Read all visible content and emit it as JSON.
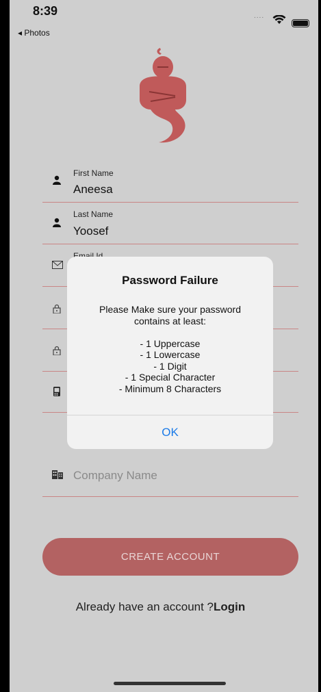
{
  "status_bar": {
    "time": "8:39",
    "back_label": "◂ Photos",
    "signal": "....",
    "battery_level": 1.0
  },
  "form": {
    "first_name": {
      "label": "First Name",
      "value": "Aneesa",
      "icon": "user-icon"
    },
    "last_name": {
      "label": "Last Name",
      "value": "Yoosef",
      "icon": "user-icon"
    },
    "email": {
      "label": "Email Id",
      "icon": "envelope-icon"
    },
    "password": {
      "icon": "lock-icon"
    },
    "confirm_password": {
      "icon": "lock-icon"
    },
    "phone": {
      "icon": "phone-icon"
    },
    "company": {
      "placeholder": "Company Name",
      "icon": "building-icon"
    }
  },
  "create_button": {
    "label": "CREATE ACCOUNT"
  },
  "login_prompt": {
    "text": "Already have an account ?",
    "link": "Login"
  },
  "alert": {
    "title": "Password Failure",
    "message": "Please Make sure your password\ncontains at least:\n\n- 1 Uppercase\n- 1 Lowercase\n- 1 Digit\n- 1 Special Character\n- Minimum 8 Characters",
    "ok_label": "OK"
  },
  "colors": {
    "accent": "#b36262",
    "link": "#1a7ae8",
    "field_line": "#c98585"
  }
}
